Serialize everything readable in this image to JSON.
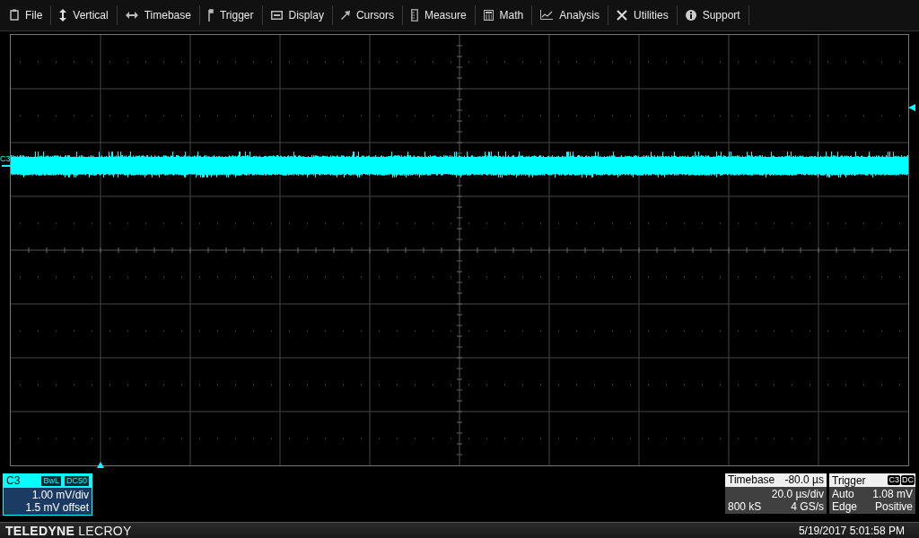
{
  "menu": [
    {
      "label": "File"
    },
    {
      "label": "Vertical"
    },
    {
      "label": "Timebase"
    },
    {
      "label": "Trigger"
    },
    {
      "label": "Display"
    },
    {
      "label": "Cursors"
    },
    {
      "label": "Measure"
    },
    {
      "label": "Math"
    },
    {
      "label": "Analysis"
    },
    {
      "label": "Utilities"
    },
    {
      "label": "Support"
    }
  ],
  "trace": {
    "label": "C3"
  },
  "channel": {
    "name": "C3",
    "badges": [
      "BwL",
      "DC50"
    ],
    "scale": "1.00 mV/div",
    "offset": "1.5 mV offset"
  },
  "timebase": {
    "title": "Timebase",
    "delay": "-80.0 µs",
    "scale": "20.0 µs/div",
    "samples": "800 kS",
    "rate": "4 GS/s"
  },
  "trigger": {
    "title": "Trigger",
    "badges": [
      "C3",
      "DC"
    ],
    "mode": "Auto",
    "level": "1.08 mV",
    "type": "Edge",
    "slope": "Positive"
  },
  "footer": {
    "brand": "**TELEDYNE** LECROY",
    "datetime": "5/19/2017 5:01:58 PM"
  }
}
